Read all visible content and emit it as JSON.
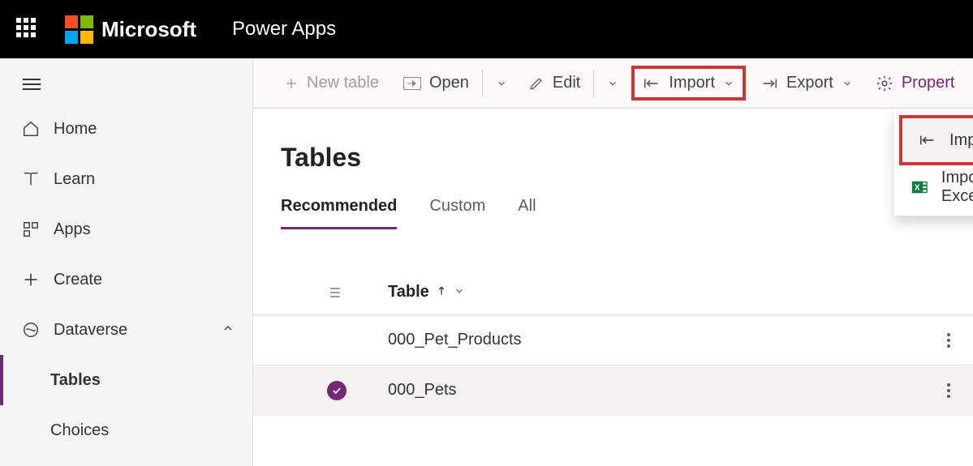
{
  "header": {
    "brand": "Microsoft",
    "app_name": "Power Apps"
  },
  "sidebar": {
    "items": [
      {
        "label": "Home"
      },
      {
        "label": "Learn"
      },
      {
        "label": "Apps"
      },
      {
        "label": "Create"
      },
      {
        "label": "Dataverse",
        "sub": [
          {
            "label": "Tables",
            "active": true
          },
          {
            "label": "Choices"
          }
        ]
      }
    ]
  },
  "cmdbar": {
    "new_table": "New table",
    "open": "Open",
    "edit": "Edit",
    "import": "Import",
    "export": "Export",
    "properties": "Propert"
  },
  "dropdown": {
    "import_data": "Import data",
    "import_excel": "Import data from Excel"
  },
  "page": {
    "title": "Tables",
    "tabs": {
      "recommended": "Recommended",
      "custom": "Custom",
      "all": "All"
    }
  },
  "table": {
    "col_label": "Table",
    "rows": [
      {
        "name": "000_Pet_Products"
      },
      {
        "name": "000_Pets"
      }
    ]
  }
}
